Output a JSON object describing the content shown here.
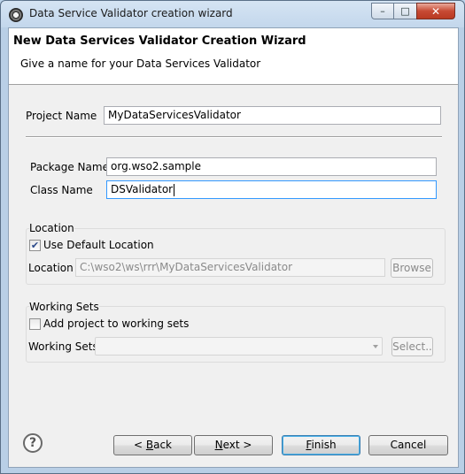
{
  "window": {
    "title": "Data Service Validator creation wizard",
    "minimize": "–",
    "maximize": "□",
    "close": "✕"
  },
  "wizard": {
    "title": "New Data Services Validator Creation Wizard",
    "subtitle": "Give a name for your Data Services Validator"
  },
  "form": {
    "project_name_label": "Project Name",
    "project_name_value": "MyDataServicesValidator",
    "package_name_label": "Package Name",
    "package_name_value": "org.wso2.sample",
    "class_name_label": "Class Name",
    "class_name_value": "DSValidator"
  },
  "location": {
    "group_title": "Location",
    "use_default_label": "Use Default Location",
    "use_default_checked": true,
    "location_label": "Location",
    "location_value": "C:\\wso2\\ws\\rrr\\MyDataServicesValidator",
    "browse_label": "Browse"
  },
  "working_sets": {
    "group_title": "Working Sets",
    "add_label": "Add project to working sets",
    "add_checked": false,
    "working_sets_label": "Working Sets",
    "working_sets_value": "",
    "select_label": "Select.."
  },
  "buttons": {
    "help_icon": "question-icon",
    "back_prefix": "< ",
    "back_mnemonic": "B",
    "back_rest": "ack",
    "next_mnemonic": "N",
    "next_rest": "ext >",
    "finish_mnemonic": "F",
    "finish_rest": "inish",
    "cancel_label": "Cancel"
  }
}
